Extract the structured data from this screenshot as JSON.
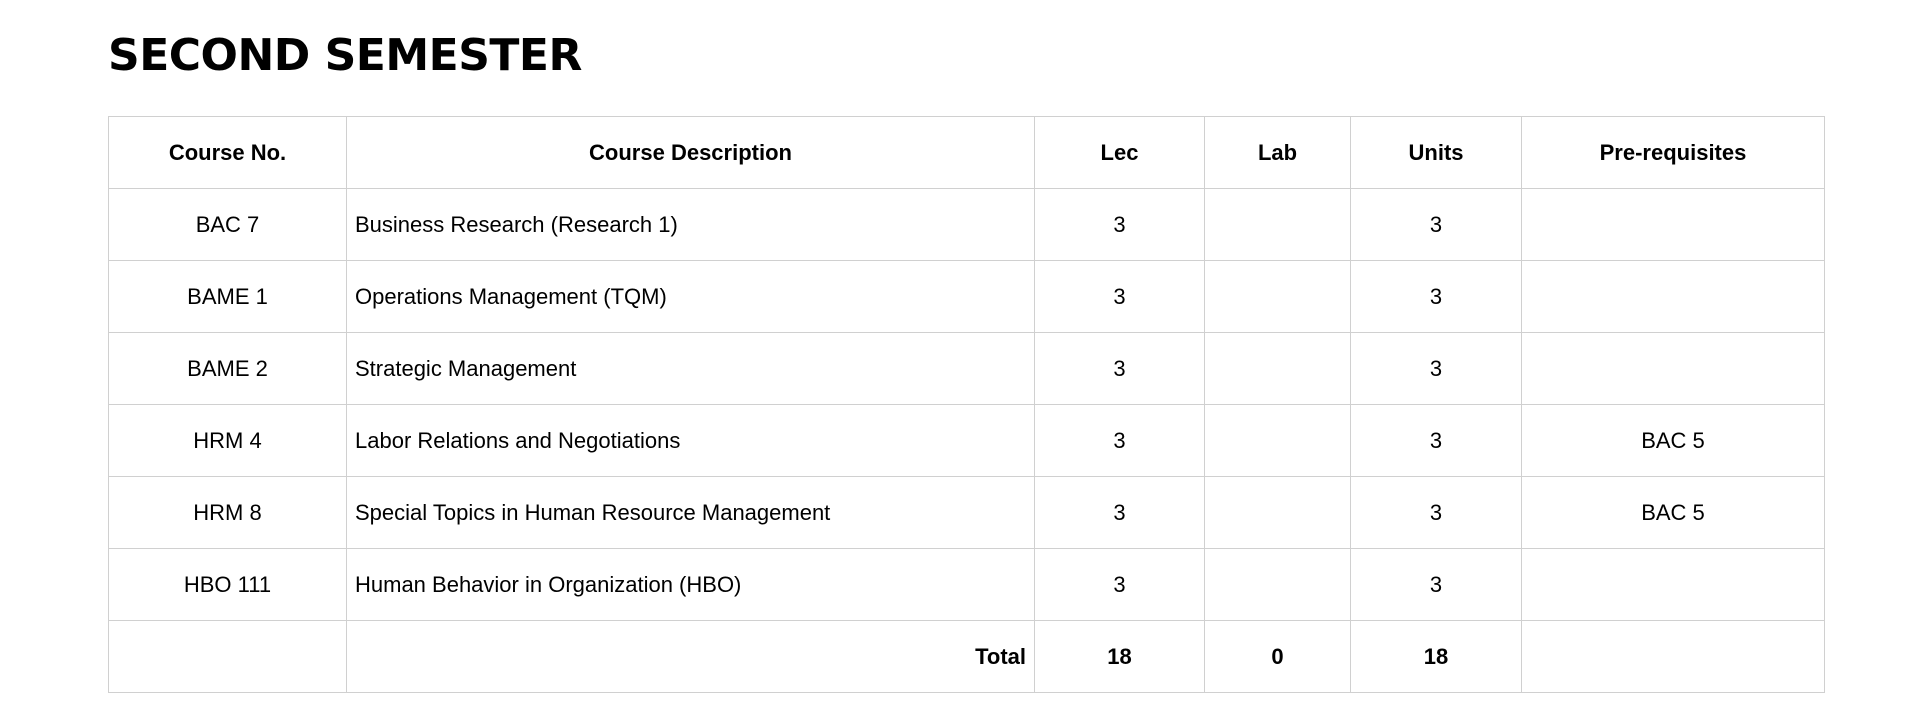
{
  "page_title": "SECOND SEMESTER",
  "table": {
    "headers": {
      "course_no": "Course No.",
      "course_description": "Course Description",
      "lec": "Lec",
      "lab": "Lab",
      "units": "Units",
      "prerequisites": "Pre-requisites"
    },
    "rows": [
      {
        "course_no": "BAC 7",
        "description": "Business Research (Research 1)",
        "lec": "3",
        "lab": "",
        "units": "3",
        "prerequisites": ""
      },
      {
        "course_no": "BAME 1",
        "description": "Operations Management (TQM)",
        "lec": "3",
        "lab": "",
        "units": "3",
        "prerequisites": ""
      },
      {
        "course_no": "BAME 2",
        "description": "Strategic Management",
        "lec": "3",
        "lab": "",
        "units": "3",
        "prerequisites": ""
      },
      {
        "course_no": "HRM 4",
        "description": "Labor Relations and Negotiations",
        "lec": "3",
        "lab": "",
        "units": "3",
        "prerequisites": "BAC 5"
      },
      {
        "course_no": "HRM 8",
        "description": "Special Topics in Human Resource Management",
        "lec": "3",
        "lab": "",
        "units": "3",
        "prerequisites": "BAC 5"
      },
      {
        "course_no": "HBO 111",
        "description": "Human Behavior in Organization (HBO)",
        "lec": "3",
        "lab": "",
        "units": "3",
        "prerequisites": ""
      }
    ],
    "total": {
      "label": "Total",
      "lec": "18",
      "lab": "0",
      "units": "18"
    }
  }
}
